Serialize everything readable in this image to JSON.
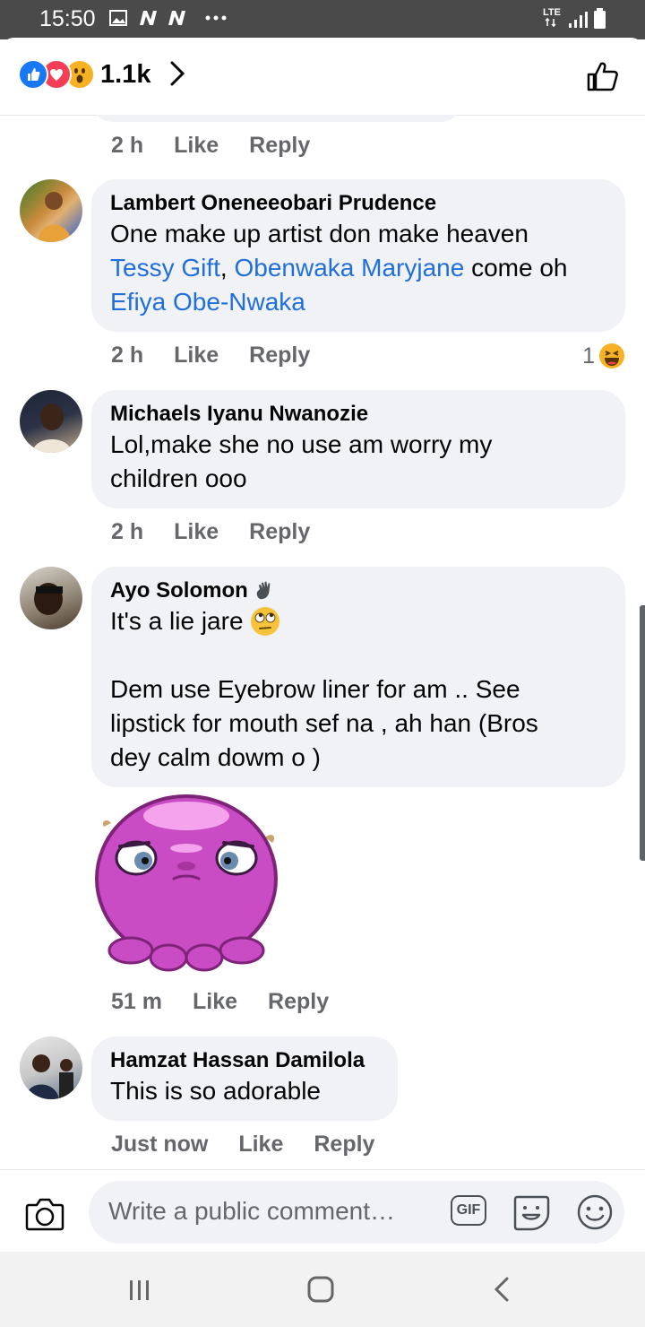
{
  "status_bar": {
    "time": "15:50",
    "network": "LTE"
  },
  "header": {
    "reaction_count": "1.1k",
    "reaction_icons": [
      "like-icon",
      "love-icon",
      "wow-icon"
    ]
  },
  "comments": [
    {
      "time": "2 h",
      "like_label": "Like",
      "reply_label": "Reply"
    },
    {
      "author": "Lambert Oneneeobari Prudence",
      "text_plain": "One make up artist don make heaven",
      "tag1": "Tessy Gift",
      "sep": ", ",
      "tag2": "Obenwaka Maryjane",
      "after": " come oh",
      "tag3": "Efiya Obe-Nwaka",
      "time": "2 h",
      "like_label": "Like",
      "reply_label": "Reply",
      "reaction_count": "1"
    },
    {
      "author": "Michaels Iyanu Nwanozie",
      "text": "Lol,make she no use am worry my\nchildren ooo",
      "time": "2 h",
      "like_label": "Like",
      "reply_label": "Reply"
    },
    {
      "author": "Ayo Solomon",
      "text_line1": "It's a lie jare ",
      "text_rest": "Dem use Eyebrow liner for am .. See\nlipstick for mouth sef na , ah han (Bros\ndey calm dowm o )",
      "time": "51 m",
      "like_label": "Like",
      "reply_label": "Reply"
    },
    {
      "author": "Hamzat Hassan Damilola",
      "text": "This is so adorable",
      "time": "Just now",
      "like_label": "Like",
      "reply_label": "Reply"
    }
  ],
  "composer": {
    "placeholder": "Write a public comment…",
    "gif_label": "GIF"
  }
}
